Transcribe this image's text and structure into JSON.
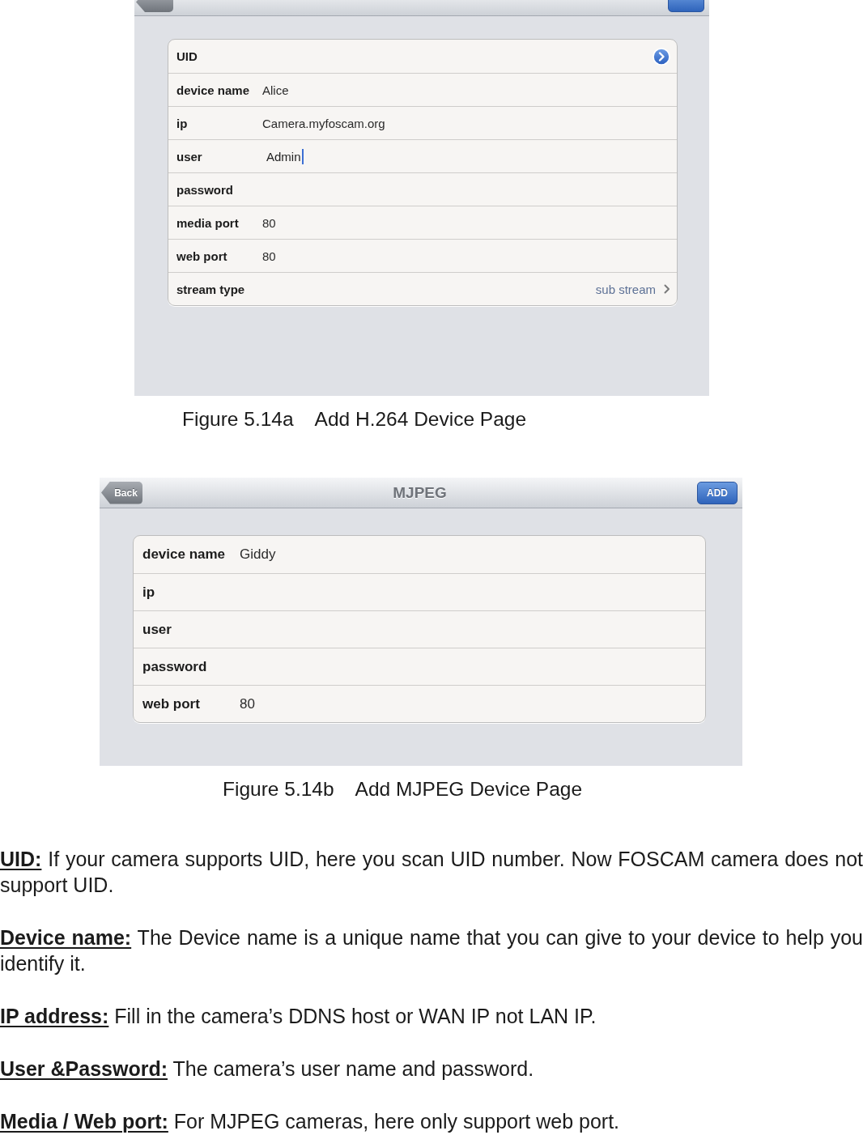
{
  "figures": [
    {
      "rows": [
        {
          "kind": "disclosure",
          "label": "UID"
        },
        {
          "kind": "field",
          "label": "device name",
          "value": "Alice",
          "focused": false
        },
        {
          "kind": "field",
          "label": "ip",
          "value": "Camera.myfoscam.org",
          "focused": false
        },
        {
          "kind": "field",
          "label": "user",
          "value": "Admin",
          "focused": true
        },
        {
          "kind": "field",
          "label": "password",
          "focused": false
        },
        {
          "kind": "field",
          "label": "media port",
          "value": "80",
          "focused": false
        },
        {
          "kind": "field",
          "label": "web port",
          "value": "80",
          "focused": false
        },
        {
          "kind": "picker",
          "label": "stream type",
          "value": "sub stream"
        }
      ],
      "caption": {
        "number": "Figure 5.14a",
        "title": "Add H.264 Device Page"
      }
    },
    {
      "nav_bar": {
        "back_button": "Back",
        "title": "MJPEG",
        "add_button": "ADD"
      },
      "rows": [
        {
          "label": "device name",
          "value": "Giddy"
        },
        {
          "label": "ip"
        },
        {
          "label": "user"
        },
        {
          "label": "password"
        },
        {
          "label": "web port",
          "value": "80"
        }
      ],
      "caption": {
        "number": "Figure 5.14b",
        "title": "Add MJPEG Device Page"
      }
    }
  ],
  "paragraphs": [
    "**UID:** If your camera supports UID, here you scan UID number. Now FOSCAM camera does not support UID.",
    "**Device name:** The Device name is a unique name that you can give to your device to help you identify it.",
    "**IP address:** Fill in the camera’s DDNS host or WAN IP not LAN IP.",
    "**User &Password:** The camera’s user name and password.",
    "**Media / Web port:** For MJPEG cameras, here only support web port."
  ]
}
